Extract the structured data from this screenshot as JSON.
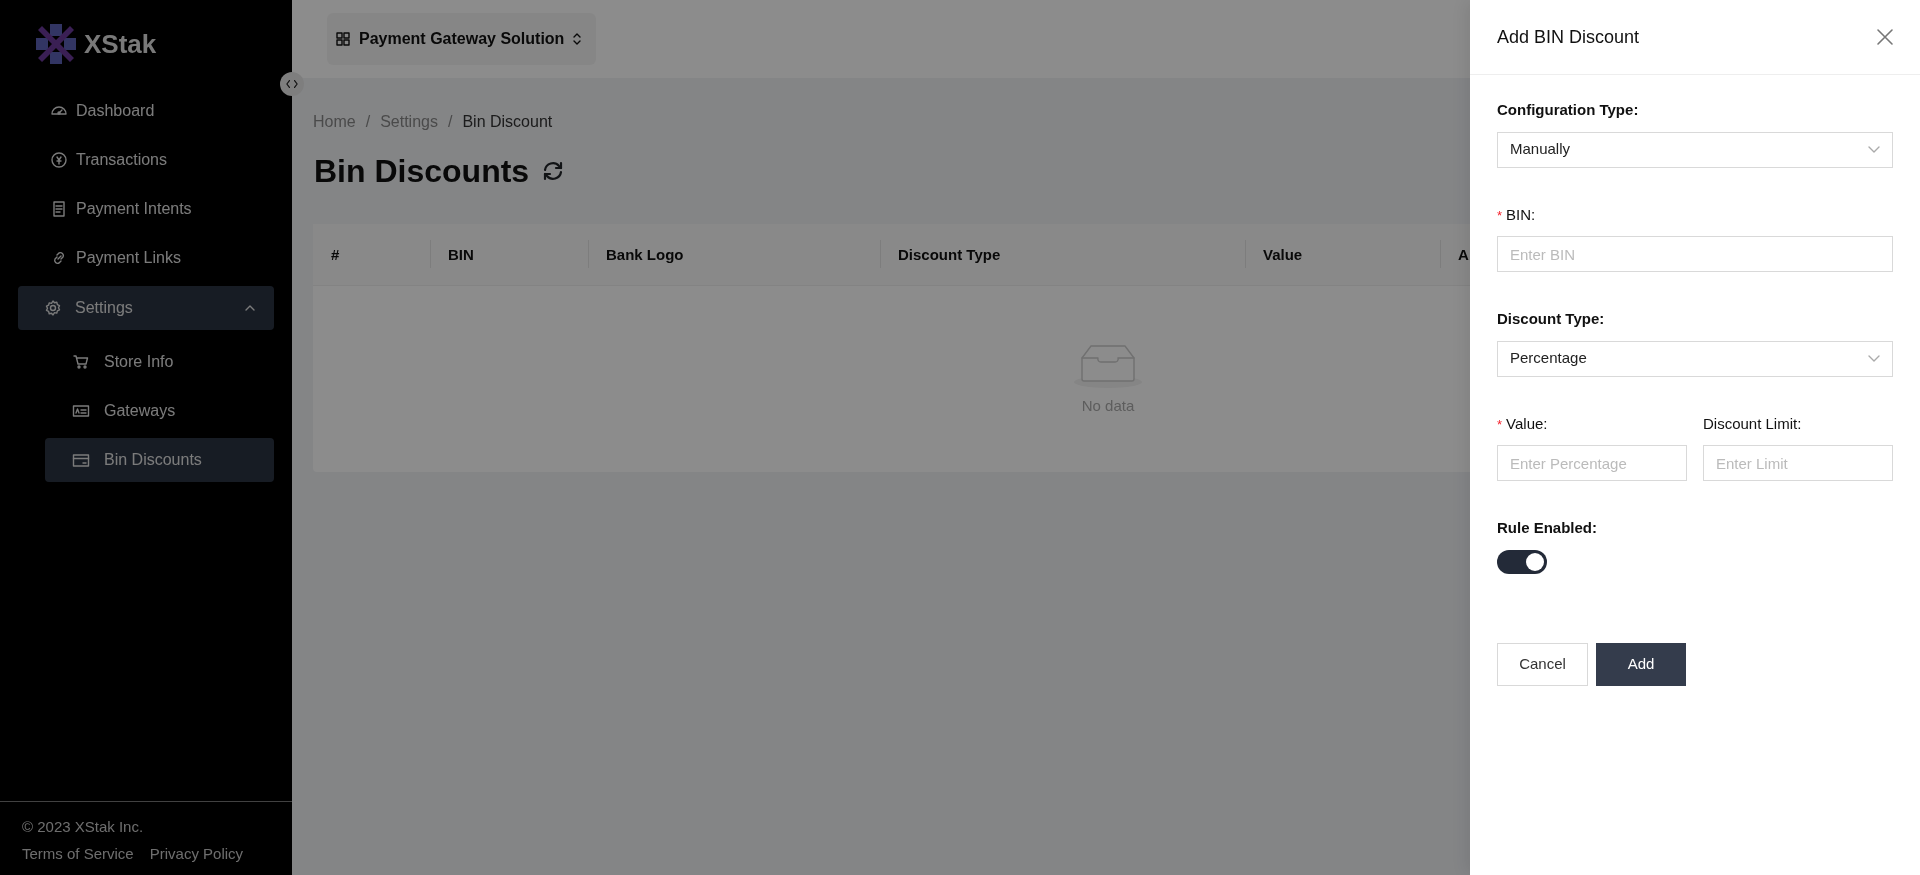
{
  "sidebar": {
    "logo": "XStak",
    "items": [
      {
        "label": "Dashboard",
        "selected": false
      },
      {
        "label": "Transactions",
        "selected": false
      },
      {
        "label": "Payment Intents",
        "selected": false
      },
      {
        "label": "Payment Links",
        "selected": false
      },
      {
        "label": "Settings",
        "expanded": true,
        "children": [
          {
            "label": "Store Info",
            "selected": false
          },
          {
            "label": "Gateways",
            "selected": false
          },
          {
            "label": "Bin Discounts",
            "selected": true
          }
        ]
      }
    ],
    "footer": {
      "copyright": "© 2023 XStak Inc.",
      "links": [
        "Terms of Service",
        "Privacy Policy"
      ]
    }
  },
  "header": {
    "project": "Payment Gateway Solution"
  },
  "breadcrumb": [
    {
      "label": "Home",
      "selected": false
    },
    {
      "separator": "/",
      "label": "Settings",
      "selected": false
    },
    {
      "separator": "/",
      "label": "Bin Discount",
      "selected": true
    }
  ],
  "page_title": "Bin Discounts",
  "table": {
    "columns": [
      "#",
      "BIN",
      "Bank Logo",
      "Discount Type",
      "Value",
      "A"
    ],
    "empty_text": "No data"
  },
  "drawer": {
    "title": "Add BIN Discount",
    "fields": [
      {
        "kind": "select",
        "label": "Configuration Type:",
        "value": "Manually"
      },
      {
        "kind": "input",
        "label": "BIN:",
        "required_mark": "*",
        "placeholder": "Enter BIN"
      },
      {
        "kind": "select",
        "label": "Discount Type:",
        "value": "Percentage"
      },
      {
        "kind": "pair",
        "fields": [
          {
            "kind": "input",
            "label": "Value:",
            "required_mark": "*",
            "placeholder": "Enter Percentage"
          },
          {
            "kind": "input",
            "label": "Discount Limit:",
            "placeholder": "Enter Limit"
          }
        ]
      },
      {
        "kind": "toggle",
        "label": "Rule Enabled:",
        "on": true
      }
    ],
    "buttons": [
      {
        "label": "Cancel",
        "kind": "secondary"
      },
      {
        "label": "Add",
        "kind": "primary"
      }
    ]
  }
}
